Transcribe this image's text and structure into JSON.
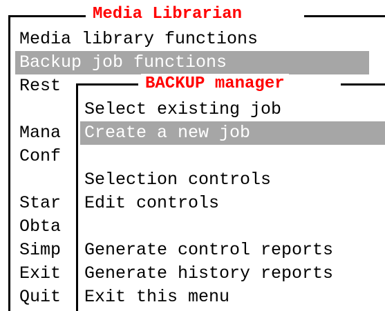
{
  "outer_menu": {
    "title": "Media Librarian",
    "items": [
      {
        "label": "Media library functions",
        "selected": false
      },
      {
        "label": "Backup job functions",
        "selected": true
      },
      {
        "label": "Rest",
        "selected": false
      },
      {
        "label": "",
        "selected": false
      },
      {
        "label": "Mana",
        "selected": false
      },
      {
        "label": "Conf",
        "selected": false
      },
      {
        "label": "",
        "selected": false
      },
      {
        "label": "Star",
        "selected": false
      },
      {
        "label": "Obta",
        "selected": false
      },
      {
        "label": "Simp",
        "selected": false
      },
      {
        "label": "Exit",
        "selected": false
      },
      {
        "label": "Quit",
        "selected": false
      }
    ]
  },
  "inner_menu": {
    "title": "BACKUP manager",
    "items": [
      {
        "label": "Select existing job",
        "selected": false
      },
      {
        "label": "Create a new job",
        "selected": true
      },
      {
        "label": "",
        "selected": false
      },
      {
        "label": "Selection controls",
        "selected": false
      },
      {
        "label": "Edit controls",
        "selected": false
      },
      {
        "label": "",
        "selected": false
      },
      {
        "label": "Generate control reports",
        "selected": false
      },
      {
        "label": "Generate history reports",
        "selected": false
      },
      {
        "label": "Exit this menu",
        "selected": false
      }
    ]
  },
  "colors": {
    "title": "#ff0000",
    "highlight_bg": "#a6a6a6",
    "highlight_fg": "#ffffff",
    "text": "#000000",
    "background": "#ffffff"
  }
}
